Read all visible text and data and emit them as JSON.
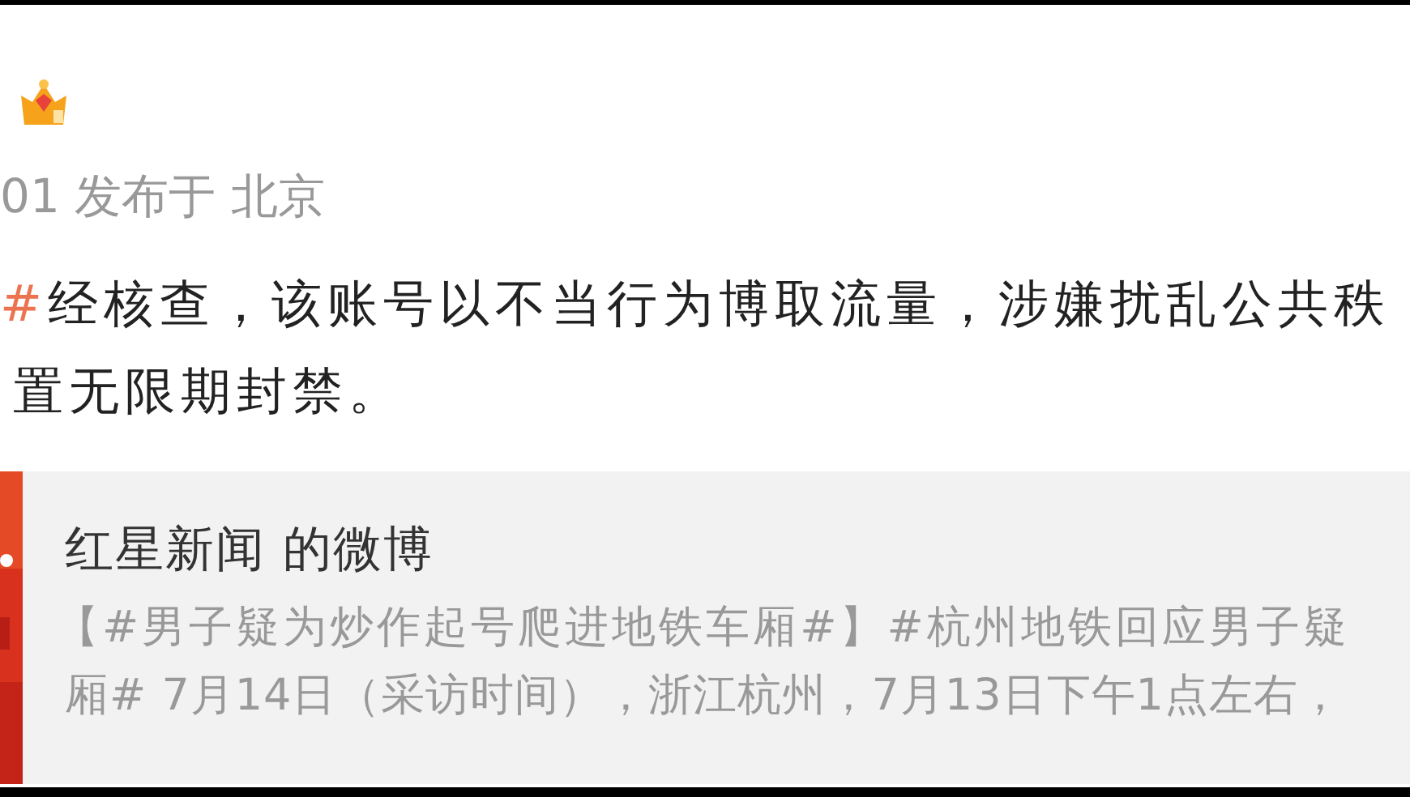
{
  "post": {
    "meta": "01 发布于 北京",
    "hashtag_end": "#",
    "lines": [
      "经核查，该账号以不当行为博取流量，涉嫌扰乱公共秩",
      "置无限期封禁。"
    ]
  },
  "repost_card": {
    "kind": "picture",
    "title": "红星新闻 的微博",
    "lines": [
      "【#男子疑为炒作起号爬进地铁车厢#】#杭州地铁回应男子疑",
      "厢# 7月14日（采访时间），浙江杭州，7月13日下午1点左右，"
    ]
  }
}
